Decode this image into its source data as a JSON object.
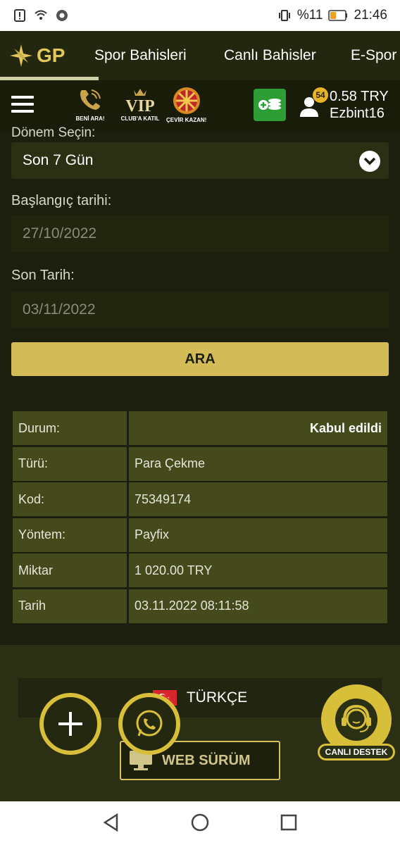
{
  "status_bar": {
    "battery": "%11",
    "time": "21:46"
  },
  "nav": {
    "logo": "GP",
    "items": [
      "Spor Bahisleri",
      "Canlı Bahisler",
      "E-Spor"
    ]
  },
  "toolbar": {
    "promos": [
      {
        "label": "BENİ ARA!",
        "icon": "phone-icon"
      },
      {
        "label": "CLUB'A KATIL",
        "icon": "vip-icon",
        "title": "VIP"
      },
      {
        "label": "ÇEVİR KAZAN!",
        "icon": "wheel-icon"
      }
    ],
    "badge": "54",
    "balance": "0.58 TRY",
    "username": "Ezbint16"
  },
  "form": {
    "period_label_cut": "Dönem Seçin:",
    "period_value": "Son 7 Gün",
    "start_label": "Başlangıç tarihi:",
    "start_value": "27/10/2022",
    "end_label": "Son Tarih:",
    "end_value": "03/11/2022",
    "search_button": "ARA"
  },
  "details": [
    {
      "key": "Durum:",
      "value": "Kabul edildi"
    },
    {
      "key": "Türü:",
      "value": "Para Çekme"
    },
    {
      "key": "Kod:",
      "value": "75349174"
    },
    {
      "key": "Yöntem:",
      "value": "Payfix"
    },
    {
      "key": "Miktar",
      "value": "1 020.00 TRY"
    },
    {
      "key": "Tarih",
      "value": "03.11.2022 08:11:58"
    }
  ],
  "footer": {
    "language": "TÜRKÇE",
    "web_version": "WEB SÜRÜM",
    "live_support": "CANLI DESTEK"
  },
  "colors": {
    "gold": "#d3bb58",
    "olive_cell": "#444a1c",
    "bg": "#1c1f0e",
    "deposit_green": "#2d9e36"
  }
}
